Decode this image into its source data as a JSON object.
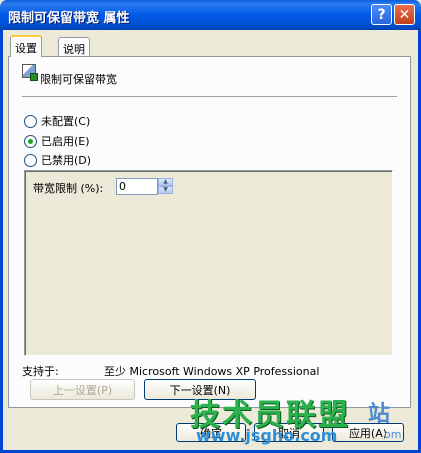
{
  "window": {
    "title": "限制可保留带宽 属性",
    "help_glyph": "?",
    "close_glyph": "✕"
  },
  "tabs": [
    {
      "label": "设置"
    },
    {
      "label": "说明"
    }
  ],
  "policy": {
    "name": "限制可保留带宽"
  },
  "radios": [
    {
      "label": "未配置(C)",
      "selected": false
    },
    {
      "label": "已启用(E)",
      "selected": true
    },
    {
      "label": "已禁用(D)",
      "selected": false
    }
  ],
  "setting": {
    "label": "带宽限制 (%):",
    "value": "0"
  },
  "supported": {
    "label": "支持于:",
    "value": "至少 Microsoft Windows XP Professional"
  },
  "nav_buttons": {
    "prev": "上一设置(P)",
    "next": "下一设置(N)"
  },
  "dialog_buttons": [
    "确定",
    "取消",
    "应用(A)"
  ],
  "watermark": {
    "main": "技术员联盟",
    "end": "站",
    "url": "www.jsgho.com",
    "end_url": "om"
  },
  "colors": {
    "titlebar": "#0058e6",
    "window_bg": "#ece9d8",
    "radio_selected": "#21a121",
    "watermark_green": "#2bb24c"
  }
}
